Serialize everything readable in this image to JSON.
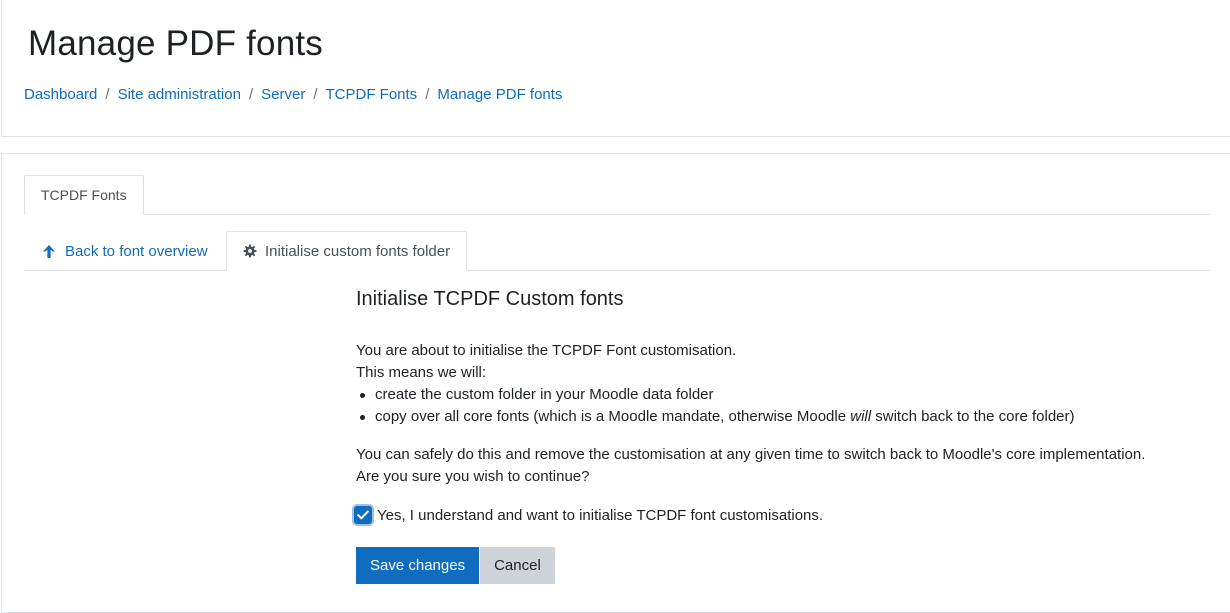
{
  "page": {
    "title": "Manage PDF fonts"
  },
  "breadcrumb": {
    "items": [
      "Dashboard",
      "Site administration",
      "Server",
      "TCPDF Fonts",
      "Manage PDF fonts"
    ],
    "separator": "/"
  },
  "tabs": {
    "primary": "TCPDF Fonts",
    "back_label": "Back to font overview",
    "active_label": "Initialise custom fonts folder"
  },
  "content": {
    "heading": "Initialise TCPDF Custom fonts",
    "intro_line1": "You are about to initialise the TCPDF Font customisation.",
    "intro_line2": "This means we will:",
    "bullet1": "create the custom folder in your Moodle data folder",
    "bullet2_before": "copy over all core fonts (which is a Moodle mandate, otherwise Moodle ",
    "bullet2_em": "will",
    "bullet2_after": " switch back to the core folder)",
    "safe_line1": "You can safely do this and remove the customisation at any given time to switch back to Moodle's core implementation.",
    "safe_line2": "Are you sure you wish to continue?",
    "confirm_label": "Yes, I understand and want to initialise TCPDF font customisations.",
    "confirm_checked": true
  },
  "buttons": {
    "save_label": "Save changes",
    "cancel_label": "Cancel"
  },
  "colors": {
    "link": "#0f6cbf",
    "primary": "#0f6cbf",
    "secondary": "#ced4da",
    "border": "#dee2e6"
  },
  "icons": {
    "back": "arrow-up-icon",
    "active": "gear-icon",
    "check": "checkmark-icon"
  }
}
